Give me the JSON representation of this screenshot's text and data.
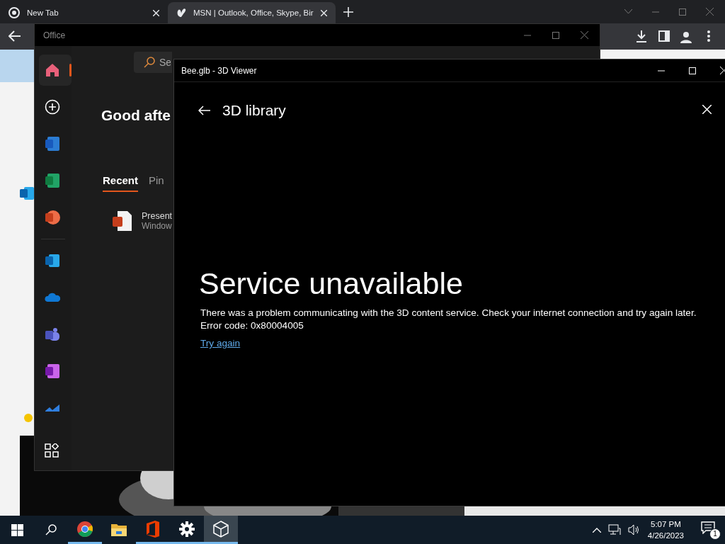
{
  "browser": {
    "tabs": [
      {
        "title": "New Tab",
        "selected": false
      },
      {
        "title": "MSN | Outlook, Office, Skype, Bir",
        "selected": true
      }
    ]
  },
  "office_window": {
    "title": "Office",
    "search": {
      "placeholder": "Se"
    },
    "greeting": "Good afte",
    "sidebar": {
      "items": [
        {
          "kind": "home",
          "selected": true
        },
        {
          "kind": "create",
          "selected": false
        },
        {
          "kind": "word",
          "selected": false
        },
        {
          "kind": "excel",
          "selected": false
        },
        {
          "kind": "powerpoint",
          "selected": false
        },
        {
          "kind": "outlook",
          "selected": false
        },
        {
          "kind": "onedrive",
          "selected": false
        },
        {
          "kind": "teams",
          "selected": false
        },
        {
          "kind": "onenote",
          "selected": false
        },
        {
          "kind": "todo",
          "selected": false
        }
      ]
    },
    "tabs": [
      {
        "label": "Recent",
        "selected": true
      },
      {
        "label": "Pin",
        "selected": false
      }
    ],
    "recent_files": [
      {
        "name": "Present",
        "location": "Window"
      }
    ]
  },
  "viewer_window": {
    "title": "Bee.glb - 3D Viewer",
    "heading": "3D library",
    "error_title": "Service unavailable",
    "message": "There was a problem communicating with the 3D content service. Check your internet connection and try again later.",
    "error_code": "Error code: 0x80004005",
    "link": "Try again"
  },
  "taskbar": {
    "apps": [
      {
        "kind": "chrome",
        "running": true,
        "selected": false
      },
      {
        "kind": "explorer",
        "running": false,
        "selected": false
      },
      {
        "kind": "office",
        "running": true,
        "selected": false
      },
      {
        "kind": "settings",
        "running": true,
        "selected": false
      },
      {
        "kind": "viewer",
        "running": true,
        "selected": true
      }
    ],
    "time": "5:07 PM",
    "date": "4/26/2023",
    "notifications": "1"
  }
}
